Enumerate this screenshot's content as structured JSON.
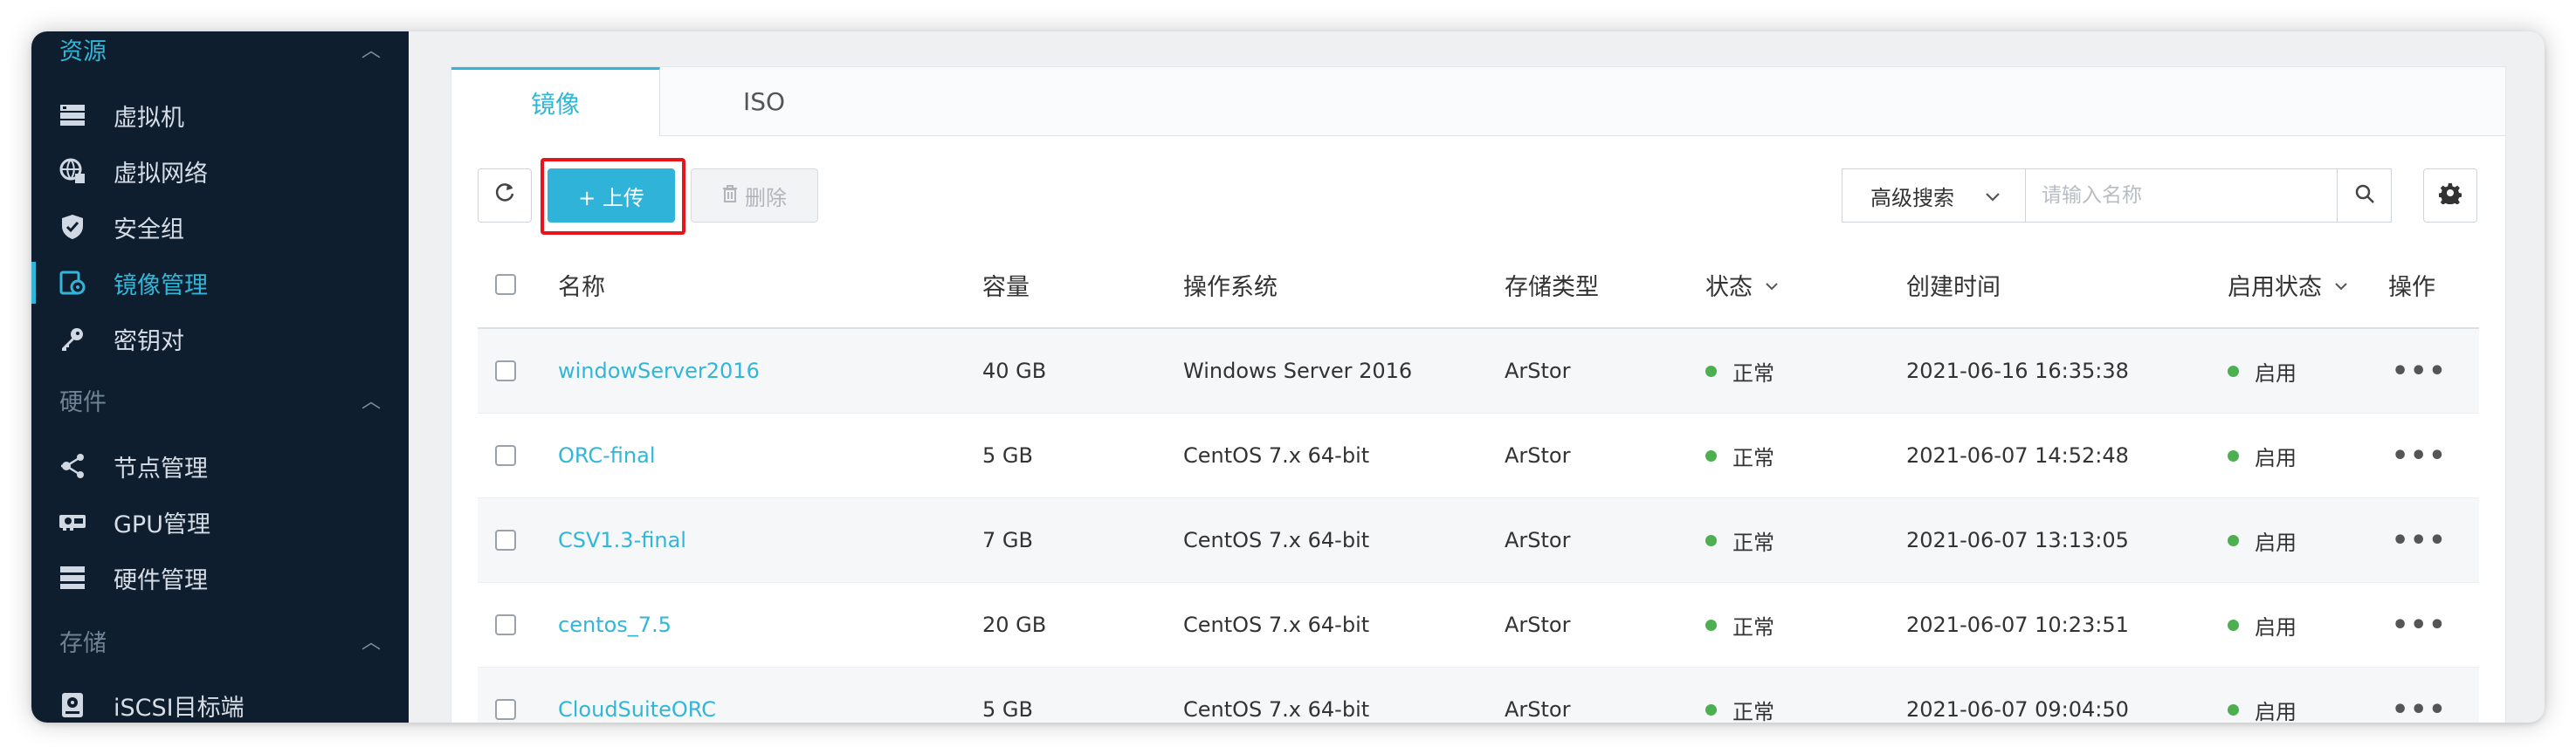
{
  "sidebar": {
    "sections": [
      {
        "label": "资源",
        "chevron": "^"
      },
      {
        "label": "硬件",
        "chevron": "^"
      },
      {
        "label": "存储",
        "chevron": "^"
      }
    ],
    "items": [
      {
        "label": "虚拟机",
        "icon": "server-icon"
      },
      {
        "label": "虚拟网络",
        "icon": "globe-network-icon"
      },
      {
        "label": "安全组",
        "icon": "shield-icon"
      },
      {
        "label": "镜像管理",
        "icon": "image-gear-icon"
      },
      {
        "label": "密钥对",
        "icon": "key-icon"
      },
      {
        "label": "节点管理",
        "icon": "nodes-icon"
      },
      {
        "label": "GPU管理",
        "icon": "gpu-icon"
      },
      {
        "label": "硬件管理",
        "icon": "hardware-icon"
      },
      {
        "label": "iSCSI目标端",
        "icon": "disk-icon"
      }
    ]
  },
  "tabs": [
    {
      "label": "镜像"
    },
    {
      "label": "ISO"
    }
  ],
  "toolbar": {
    "upload_label": "+ 上传",
    "delete_label": "删除",
    "advanced_search_label": "高级搜索",
    "search_placeholder": "请输入名称"
  },
  "table": {
    "headers": {
      "name": "名称",
      "capacity": "容量",
      "os": "操作系统",
      "storage": "存储类型",
      "status": "状态",
      "created": "创建时间",
      "enabled": "启用状态",
      "actions": "操作"
    },
    "rows": [
      {
        "name": "windowServer2016",
        "capacity": "40 GB",
        "os": "Windows Server 2016",
        "storage": "ArStor",
        "status": "正常",
        "created": "2021-06-16 16:35:38",
        "enabled": "启用"
      },
      {
        "name": "ORC-final",
        "capacity": "5 GB",
        "os": "CentOS 7.x 64-bit",
        "storage": "ArStor",
        "status": "正常",
        "created": "2021-06-07 14:52:48",
        "enabled": "启用"
      },
      {
        "name": "CSV1.3-final",
        "capacity": "7 GB",
        "os": "CentOS 7.x 64-bit",
        "storage": "ArStor",
        "status": "正常",
        "created": "2021-06-07 13:13:05",
        "enabled": "启用"
      },
      {
        "name": "centos_7.5",
        "capacity": "20 GB",
        "os": "CentOS 7.x 64-bit",
        "storage": "ArStor",
        "status": "正常",
        "created": "2021-06-07 10:23:51",
        "enabled": "启用"
      },
      {
        "name": "CloudSuiteORC",
        "capacity": "5 GB",
        "os": "CentOS 7.x 64-bit",
        "storage": "ArStor",
        "status": "正常",
        "created": "2021-06-07 09:04:50",
        "enabled": "启用"
      }
    ],
    "more_label": "•••"
  },
  "colors": {
    "accent": "#32b6d8",
    "sidebar_bg": "#0f1e2e",
    "status_ok": "#4caf50",
    "highlight": "#e8141c"
  }
}
